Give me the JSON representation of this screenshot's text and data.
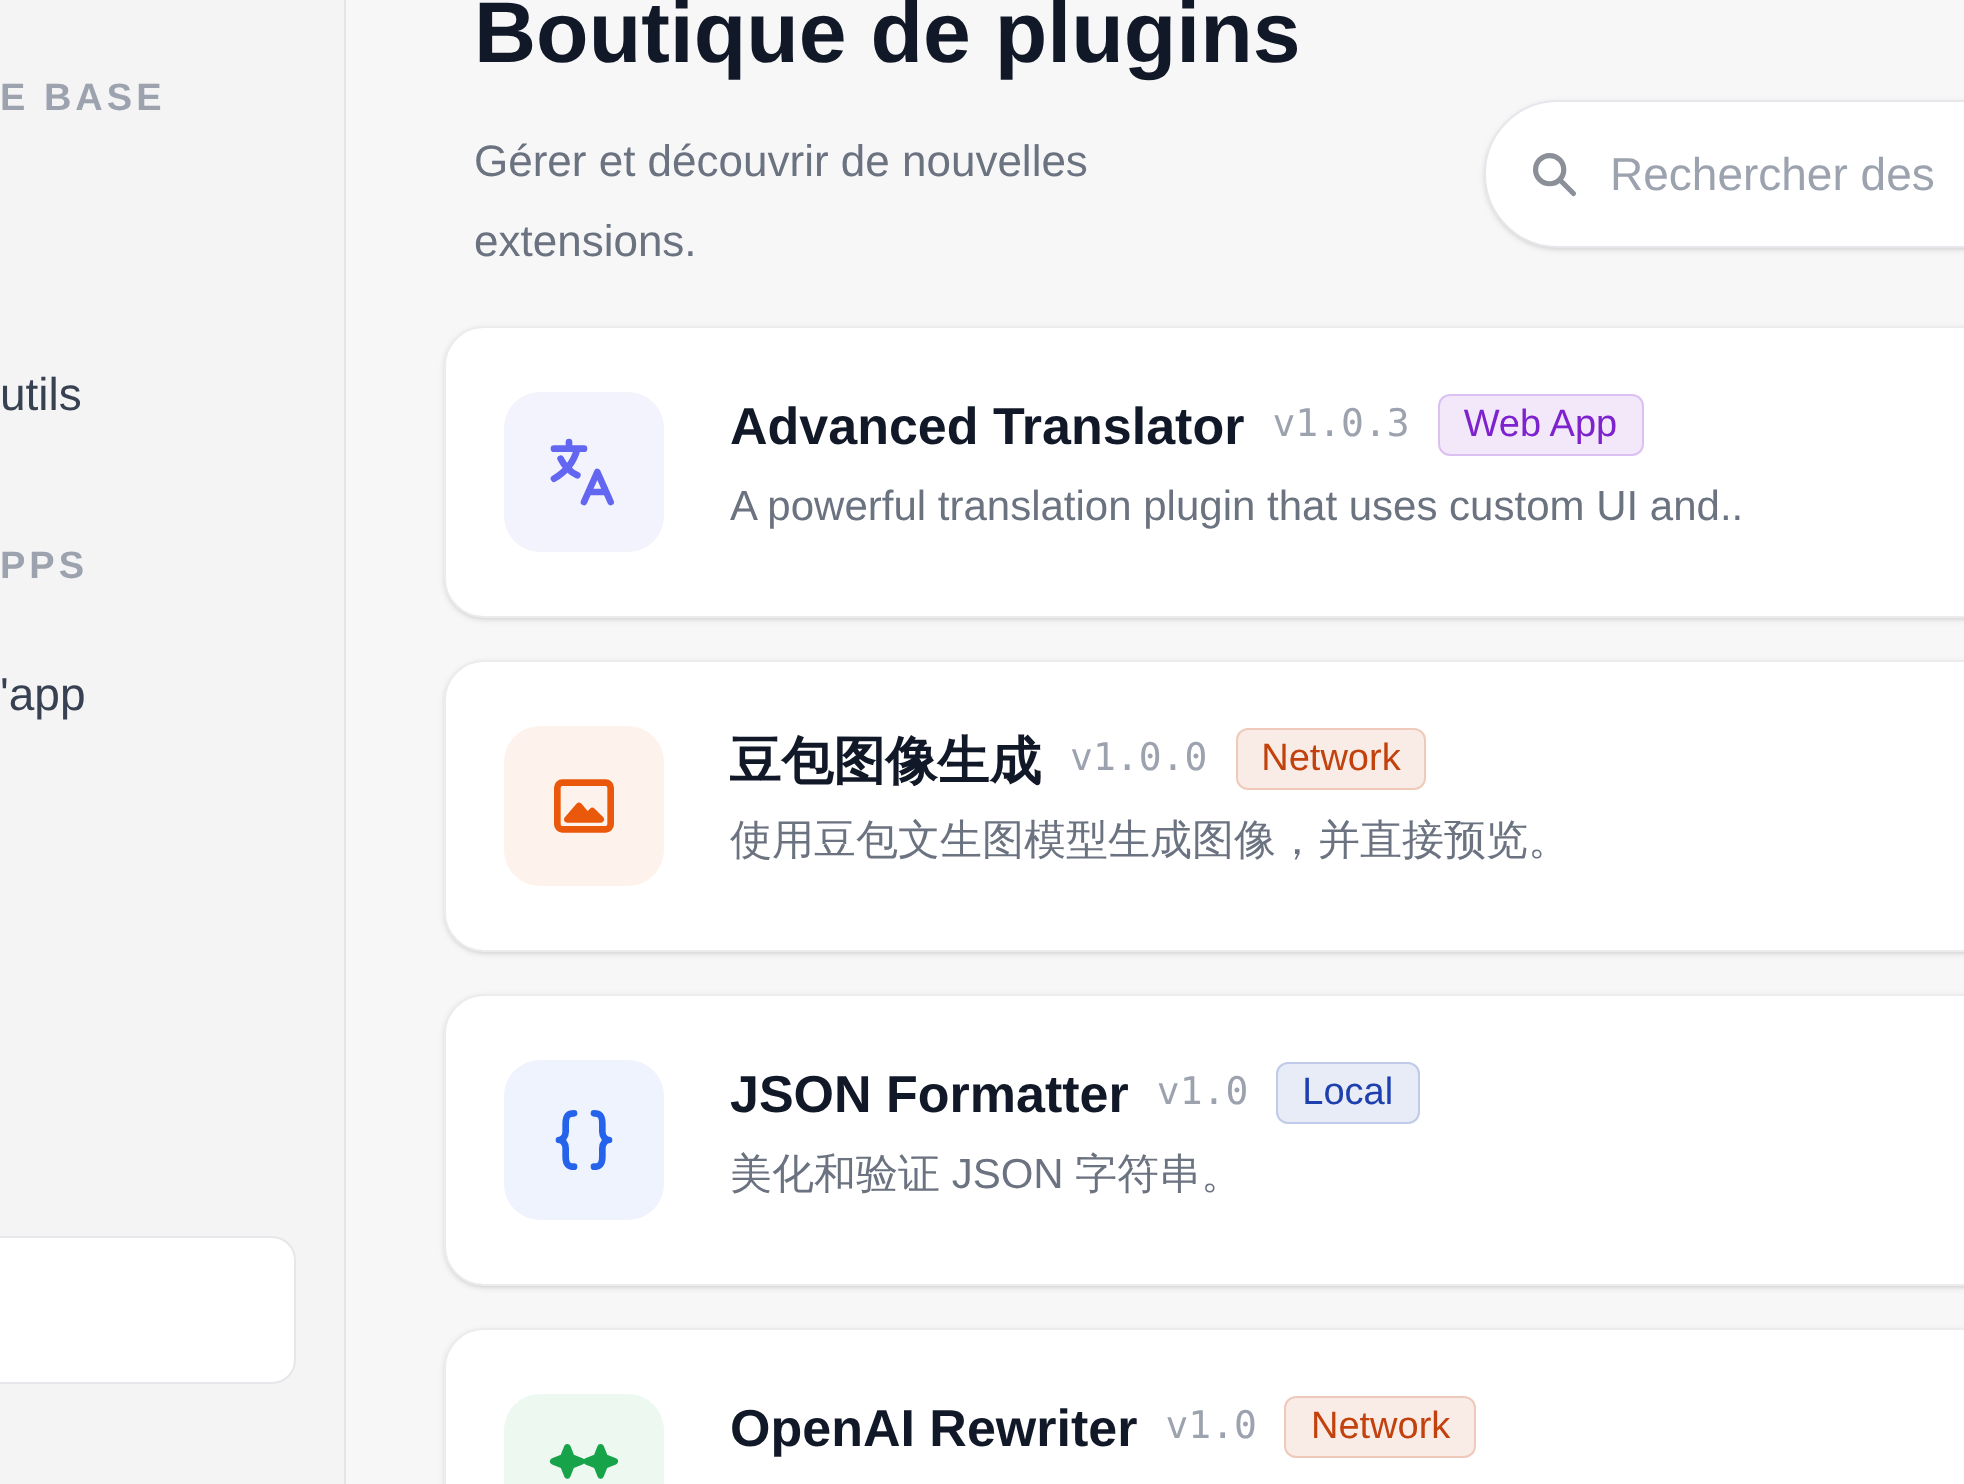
{
  "sidebar": {
    "sections": [
      {
        "heading": "E BASE",
        "items": [
          {
            "label": "utils"
          }
        ]
      },
      {
        "heading": "PPS",
        "items": [
          {
            "label": "'app"
          }
        ]
      }
    ]
  },
  "header": {
    "title": "Boutique de plugins",
    "subtitle": "Gérer et découvrir de nouvelles extensions.",
    "search": {
      "placeholder": "Rechercher des"
    }
  },
  "plugins": [
    {
      "kind": "translate",
      "color": "#6366f1",
      "name": "Advanced Translator",
      "version": "v1.0.3",
      "tag": {
        "label": "Web App",
        "color": "#7e22ce"
      },
      "description": "A powerful translation plugin that uses custom UI and.."
    },
    {
      "kind": "image",
      "color": "#ea580c",
      "name": "豆包图像生成",
      "version": "v1.0.0",
      "tag": {
        "label": "Network",
        "color": "#c2410c"
      },
      "description": "使用豆包文生图模型生成图像，并直接预览。"
    },
    {
      "kind": "braces",
      "color": "#2563eb",
      "name": "JSON Formatter",
      "version": "v1.0",
      "tag": {
        "label": "Local",
        "color": "#1e40af"
      },
      "description": "美化和验证 JSON 字符串。"
    },
    {
      "kind": "sparkles",
      "color": "#16a34a",
      "name": "OpenAI Rewriter",
      "version": "v1.0",
      "tag": {
        "label": "Network",
        "color": "#c2410c"
      }
    }
  ]
}
